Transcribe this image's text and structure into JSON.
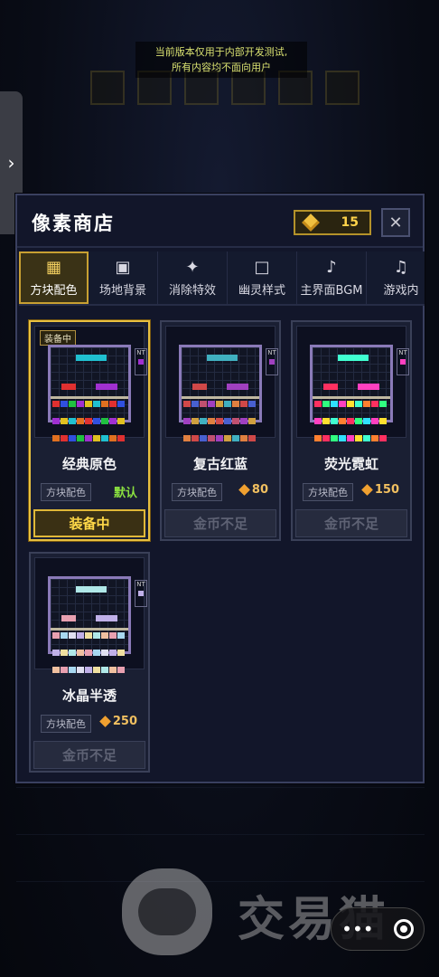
{
  "notice": {
    "line1": "当前版本仅用于内部开发测试,",
    "line2": "所有内容均不面向用户"
  },
  "shop": {
    "title": "像素商店",
    "coins": "15",
    "close_icon": "close-icon"
  },
  "tabs": [
    {
      "label": "方块配色",
      "icon": "grid-icon",
      "glyph": "▦",
      "active": true
    },
    {
      "label": "场地背景",
      "icon": "square-frame-icon",
      "glyph": "▣",
      "active": false
    },
    {
      "label": "消除特效",
      "icon": "sparkle-icon",
      "glyph": "✦",
      "active": false
    },
    {
      "label": "幽灵样式",
      "icon": "ghost-square-icon",
      "glyph": "□",
      "active": false
    },
    {
      "label": "主界面BGM",
      "icon": "music-note-icon",
      "glyph": "♪",
      "active": false
    },
    {
      "label": "游戏内",
      "icon": "music-notes-icon",
      "glyph": "♫",
      "active": false
    }
  ],
  "items": [
    {
      "name": "经典原色",
      "tag": "方块配色",
      "price": "默认",
      "is_default": true,
      "equipped": true,
      "equipped_badge": "装备中",
      "action": "装备中",
      "palette": [
        "#e03030",
        "#3050e0",
        "#20c040",
        "#a030d0",
        "#e0c020",
        "#20c0d0",
        "#e07020"
      ]
    },
    {
      "name": "复古红蓝",
      "tag": "方块配色",
      "price": "80",
      "is_default": false,
      "equipped": false,
      "action": "金币不足",
      "palette": [
        "#d04848",
        "#4860d0",
        "#c05070",
        "#a040c0",
        "#d0a040",
        "#40b0c0",
        "#e08040"
      ]
    },
    {
      "name": "荧光霓虹",
      "tag": "方块配色",
      "price": "150",
      "is_default": false,
      "equipped": false,
      "action": "金币不足",
      "palette": [
        "#ff3060",
        "#30ff80",
        "#30e0ff",
        "#ff40c0",
        "#ffe030",
        "#40ffd0",
        "#ff8030"
      ]
    },
    {
      "name": "冰晶半透",
      "tag": "方块配色",
      "price": "250",
      "is_default": false,
      "equipped": false,
      "action": "金币不足",
      "palette": [
        "#e8a0b0",
        "#a8d8f0",
        "#e0e0f0",
        "#c0b0e8",
        "#f0e0a0",
        "#b0e8e8",
        "#f0c0a0"
      ]
    }
  ],
  "watermark": {
    "text": "交易猫"
  },
  "mini_program": {
    "more_icon": "more-dots-icon",
    "close_icon": "target-close-icon",
    "more_glyph": "•••"
  },
  "side_handle": {
    "glyph": "›"
  }
}
